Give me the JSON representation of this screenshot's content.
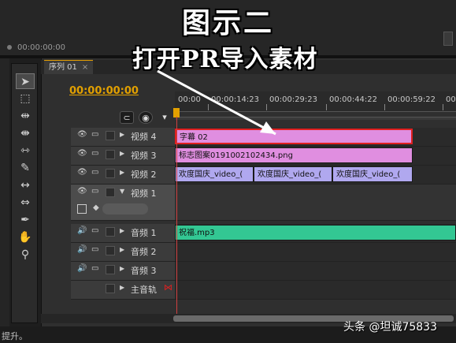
{
  "overlay": {
    "heading1": "图示二",
    "heading2": "打开PR导入素材"
  },
  "monitor": {
    "timecode": "00:00:00:00"
  },
  "sequence": {
    "tab_label": "序列 01",
    "tab_close": "×",
    "current_time": "00:00:00:00",
    "ruler_labels": [
      "00:00",
      "00:00:14:23",
      "00:00:29:23",
      "00:00:44:22",
      "00:00:59:22",
      "00"
    ]
  },
  "tracks": {
    "video": [
      {
        "name": "视频 4",
        "clips": [
          "字幕 02"
        ]
      },
      {
        "name": "视频 3",
        "clips": [
          "标志图案0191002102434.png"
        ]
      },
      {
        "name": "视频 2",
        "clips": [
          "欢度国庆_video_(",
          "欢度国庆_video_(",
          "欢度国庆_video_("
        ]
      },
      {
        "name": "视频 1",
        "clips": []
      }
    ],
    "audio": [
      {
        "name": "音频 1",
        "clips": [
          "祝福.mp3"
        ]
      },
      {
        "name": "音频 2",
        "clips": []
      },
      {
        "name": "音频 3",
        "clips": []
      },
      {
        "name": "主音轨",
        "clips": []
      }
    ]
  },
  "status": {
    "text": "提升。"
  },
  "watermark": "头条 @坦诚75833",
  "colors": {
    "accent": "#e2a000",
    "title_clip": "#e08ee0",
    "video_clip": "#b0a8ef",
    "audio_clip": "#33c793",
    "playhead": "#d04040"
  }
}
